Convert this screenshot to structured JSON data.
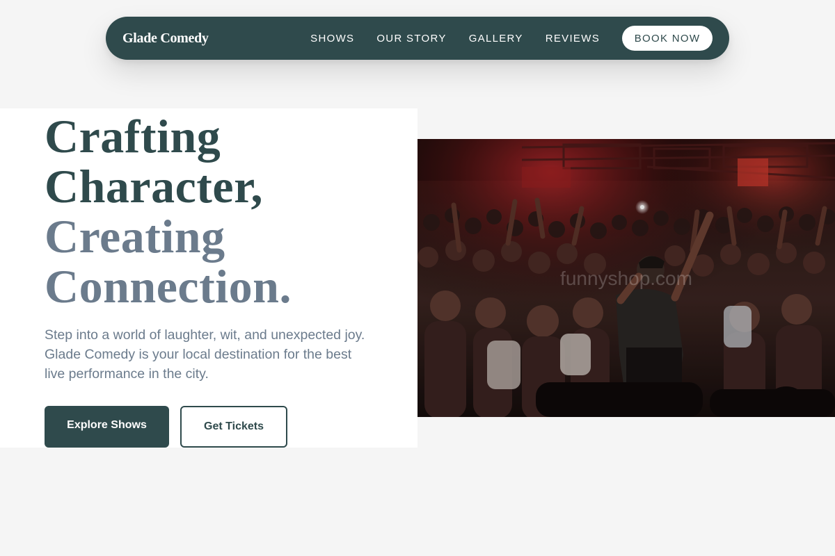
{
  "nav": {
    "brand": "Glade Comedy",
    "links": [
      "SHOWS",
      "OUR STORY",
      "GALLERY",
      "REVIEWS"
    ],
    "cta": "BOOK NOW"
  },
  "hero": {
    "headline": {
      "line1": "Crafting",
      "line2": "Character,",
      "line3": "Creating",
      "line4": "Connection."
    },
    "lead": "Step into a world of laughter, wit, and unexpected joy. Glade Comedy is your local destination for the best live performance in the city.",
    "primary_button": "Explore Shows",
    "secondary_button": "Get Tickets",
    "image": {
      "subject": "comedian performing on stage in front of a cheering crowd",
      "watermark": "funnyshop.com"
    }
  },
  "colors": {
    "brand_dark": "#2f4a4c",
    "muted_text": "#6b7b8c",
    "page_background": "#f5f5f5",
    "panel_background": "#ffffff"
  }
}
